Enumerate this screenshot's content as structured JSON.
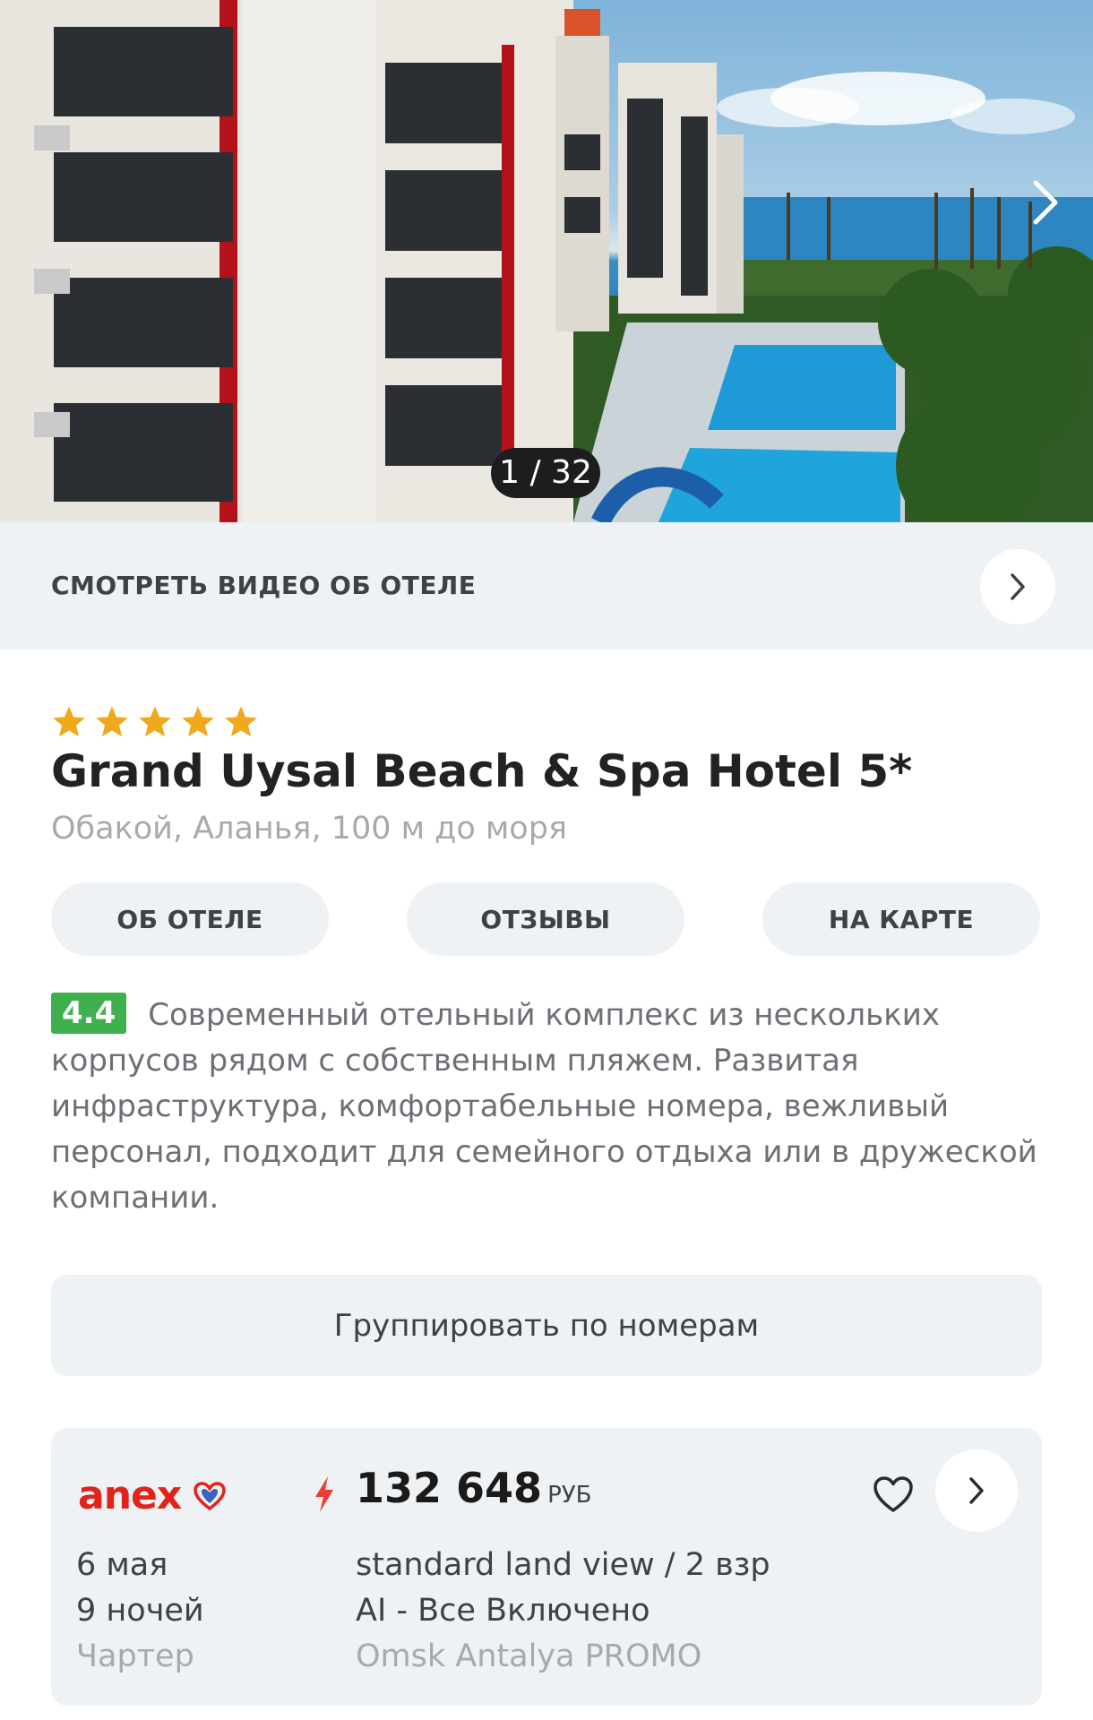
{
  "gallery": {
    "counter": "1 / 32",
    "next_icon": "chevron-right-icon"
  },
  "video": {
    "label": "СМОТРЕТЬ ВИДЕО ОБ ОТЕЛЕ",
    "icon": "chevron-right-icon"
  },
  "hotel": {
    "stars": 5,
    "name": "Grand Uysal Beach & Spa Hotel 5*",
    "location": "Обакой, Аланья, 100 м до моря"
  },
  "tabs": [
    {
      "label": "ОБ ОТЕЛЕ"
    },
    {
      "label": "ОТЗЫВЫ"
    },
    {
      "label": "НА КАРТЕ"
    }
  ],
  "description": {
    "rating": "4.4",
    "text": "Современный отельный комплекс из нескольких корпусов рядом с собственным пляжем. Развитая инфраструктура, комфортабельные номера, вежливый персонал, подходит для семейного отдыха или в дружеской компании."
  },
  "group_button": {
    "label": "Группировать по номерам"
  },
  "offer": {
    "operator": "anex",
    "price": "132 648",
    "currency": "РУБ",
    "date": "6 мая",
    "nights": "9 ночей",
    "flight_type": "Чартер",
    "room": "standard land view / 2 взр",
    "meal": "AI - Все Включено",
    "tariff": "Omsk Antalya PROMO",
    "colors": {
      "brand": "#e2231a",
      "bolt": "#ef3b36",
      "rating": "#3fb04e"
    }
  }
}
